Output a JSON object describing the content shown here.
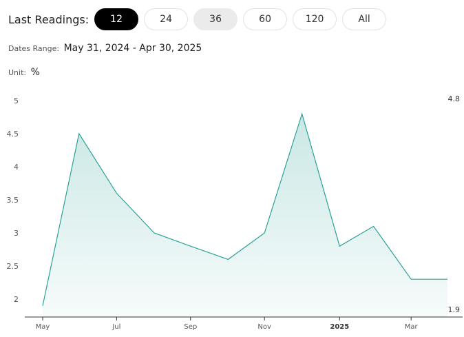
{
  "header": {
    "label": "Last Readings:",
    "options": [
      {
        "label": "12",
        "state": "active"
      },
      {
        "label": "24",
        "state": "normal"
      },
      {
        "label": "36",
        "state": "hover"
      },
      {
        "label": "60",
        "state": "normal"
      },
      {
        "label": "120",
        "state": "normal"
      },
      {
        "label": "All",
        "state": "normal"
      }
    ]
  },
  "dates": {
    "label": "Dates Range:",
    "value": "May 31, 2024 - Apr 30, 2025"
  },
  "unit": {
    "label": "Unit:",
    "value": "%"
  },
  "chart_data": {
    "type": "area",
    "x": [
      "2024-05-31",
      "2024-06-30",
      "2024-07-31",
      "2024-08-31",
      "2024-09-30",
      "2024-10-31",
      "2024-11-30",
      "2024-12-31",
      "2025-01-31",
      "2025-02-28",
      "2025-03-31",
      "2025-04-30"
    ],
    "values": [
      1.9,
      4.5,
      3.6,
      3.0,
      2.8,
      2.6,
      3.0,
      4.8,
      2.8,
      3.1,
      2.3,
      2.3
    ],
    "ylim": [
      1.75,
      5.1
    ],
    "yticks": [
      "5",
      "4.5",
      "4",
      "3.5",
      "3",
      "2.5",
      "2"
    ],
    "xticks": [
      {
        "label": "May",
        "date": "2024-05-31"
      },
      {
        "label": "Jul",
        "date": "2024-07-31"
      },
      {
        "label": "Sep",
        "date": "2024-09-30"
      },
      {
        "label": "Nov",
        "date": "2024-11-30"
      },
      {
        "label": "2025",
        "date": "2025-01-31",
        "bold": true
      },
      {
        "label": "Mar",
        "date": "2025-03-31"
      }
    ],
    "max_label": "4.8",
    "min_label": "1.9",
    "line_color": "#2aa198",
    "fill_color": "#2aa198",
    "grid": false
  }
}
